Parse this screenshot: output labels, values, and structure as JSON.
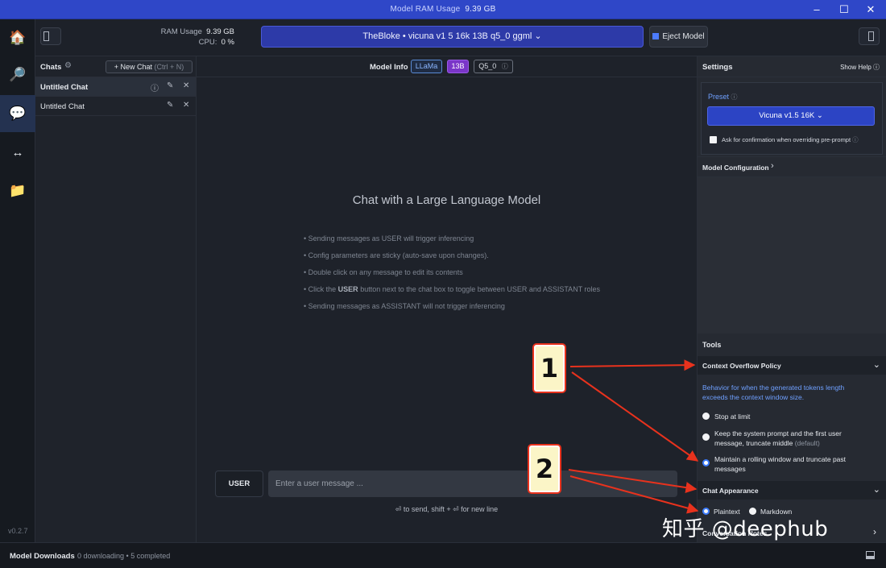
{
  "window": {
    "title_label": "Model RAM Usage",
    "title_value": "9.39 GB"
  },
  "rail": {
    "items": [
      "home-icon",
      "search-icon",
      "chat-icon",
      "transfer-icon",
      "folder-icon"
    ],
    "version": "v0.2.7"
  },
  "topbar": {
    "ram_label": "RAM Usage",
    "ram_value": "9.39 GB",
    "cpu_label": "CPU:",
    "cpu_value": "0 %",
    "model_name": "TheBloke • vicuna v1 5 16k 13B q5_0 ggml",
    "eject_label": "Eject Model"
  },
  "chats": {
    "title": "Chats",
    "new_chat": "+ New Chat",
    "new_chat_shortcut": "(Ctrl + N)",
    "items": [
      {
        "name": "Untitled Chat"
      },
      {
        "name": "Untitled Chat"
      }
    ]
  },
  "main": {
    "model_info_label": "Model Info",
    "tags": [
      "LLaMa",
      "13B",
      "Q5_0"
    ],
    "empty_title": "Chat with a Large Language Model",
    "tips": [
      "• Sending messages as USER will trigger inferencing",
      "• Config parameters are sticky (auto-save upon changes).",
      "• Double click on any message to edit its contents",
      "• Sending messages as ASSISTANT will not trigger inferencing"
    ],
    "tip_click_prefix": "• Click the ",
    "tip_click_bold": "USER",
    "tip_click_suffix": " button next to the chat box to toggle between USER and ASSISTANT roles",
    "role_button": "USER",
    "input_placeholder": "Enter a user message ...",
    "send_hint": "⏎ to send, shift + ⏎ for new line"
  },
  "settings": {
    "title": "Settings",
    "show_help": "Show Help",
    "preset_label": "Preset",
    "preset_value": "Vicuna v1.5 16K",
    "confirm_label": "Ask for confirmation when overriding pre-prompt",
    "model_config": "Model Configuration",
    "tools_label": "Tools",
    "overflow_title": "Context Overflow Policy",
    "overflow_desc": "Behavior for when the generated tokens length exceeds the context window size.",
    "opt_stop": "Stop at limit",
    "opt_keep": "Keep the system prompt and the first user message, truncate middle",
    "opt_keep_default": "(default)",
    "opt_rolling": "Maintain a rolling window and truncate past messages",
    "appearance_title": "Chat Appearance",
    "appearance_plain": "Plaintext",
    "appearance_markdown": "Markdown",
    "conversation_notes": "Conversation Notes"
  },
  "bottom": {
    "label": "Model Downloads",
    "status": "0 downloading • 5 completed"
  },
  "annotations": {
    "callout_1": "1",
    "callout_2": "2"
  },
  "watermark": "知乎 @deephub",
  "colors": {
    "accent": "#2d3aa8",
    "title_bar": "#2f47c8",
    "annotation_red": "#e8321d"
  }
}
